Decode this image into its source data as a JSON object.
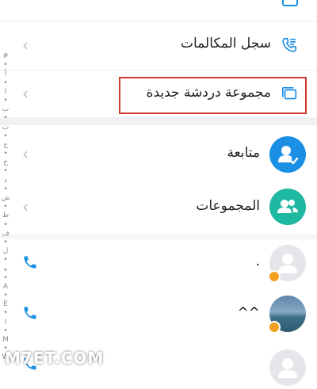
{
  "menu": {
    "call_log_label": "سجل المكالمات",
    "new_group_label": "مجموعة دردشة جديدة",
    "follow_label": "متابعة",
    "groups_label": "المجموعات"
  },
  "contacts": [
    {
      "name": "."
    },
    {
      "name": "^^"
    },
    {
      "name": ""
    }
  ],
  "index_letters": [
    "#",
    "•",
    "أ",
    "•",
    "ا",
    "•",
    "ب",
    "•",
    "ت",
    "•",
    "ج",
    "•",
    "ح",
    "•",
    "د",
    "•",
    "ش",
    "•",
    "ظ",
    "•",
    "ف",
    "•",
    "ل",
    "•",
    "ه",
    "•",
    "A",
    "•",
    "E",
    "•",
    "I",
    "•",
    "M",
    "•",
    "W"
  ],
  "watermark": "M7ET.COM",
  "colors": {
    "accent_blue": "#1a8fe3",
    "accent_teal": "#1fb8a0",
    "highlight_red": "#cd3b2e",
    "badge_orange": "#f0a01e"
  }
}
